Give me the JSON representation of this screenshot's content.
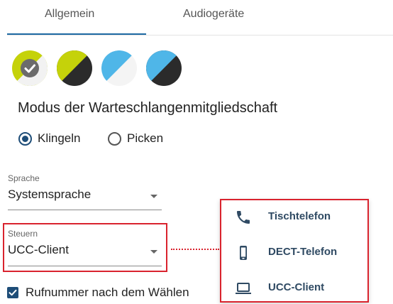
{
  "tabs": [
    {
      "label": "Allgemein",
      "active": true
    },
    {
      "label": "Audiogeräte",
      "active": false
    }
  ],
  "themes": [
    {
      "name": "yellow-gray",
      "colors": [
        "#c5d20a",
        "#666666"
      ],
      "selected": true
    },
    {
      "name": "yellow-black",
      "colors": [
        "#c5d20a",
        "#2b2b2b"
      ],
      "selected": false
    },
    {
      "name": "blue-white",
      "colors": [
        "#4fb6e8",
        "#f4f4f4"
      ],
      "selected": false
    },
    {
      "name": "blue-black",
      "colors": [
        "#4fb6e8",
        "#2b2b2b"
      ],
      "selected": false
    }
  ],
  "mode": {
    "heading": "Modus der Warteschlangenmitgliedschaft",
    "options": [
      {
        "label": "Klingeln",
        "selected": true
      },
      {
        "label": "Picken",
        "selected": false
      }
    ]
  },
  "language": {
    "label": "Sprache",
    "value": "Systemsprache"
  },
  "control": {
    "label": "Steuern",
    "value": "UCC-Client",
    "options": [
      {
        "label": "Tischtelefon",
        "icon": "phone-icon"
      },
      {
        "label": "DECT-Telefon",
        "icon": "mobile-phone-icon"
      },
      {
        "label": "UCC-Client",
        "icon": "laptop-icon"
      }
    ]
  },
  "redial": {
    "label": "Rufnummer nach dem Wählen",
    "checked": true
  },
  "colors": {
    "accent": "#1e4d78",
    "highlight": "#d9232e",
    "tab_active": "#1e6aa3"
  }
}
